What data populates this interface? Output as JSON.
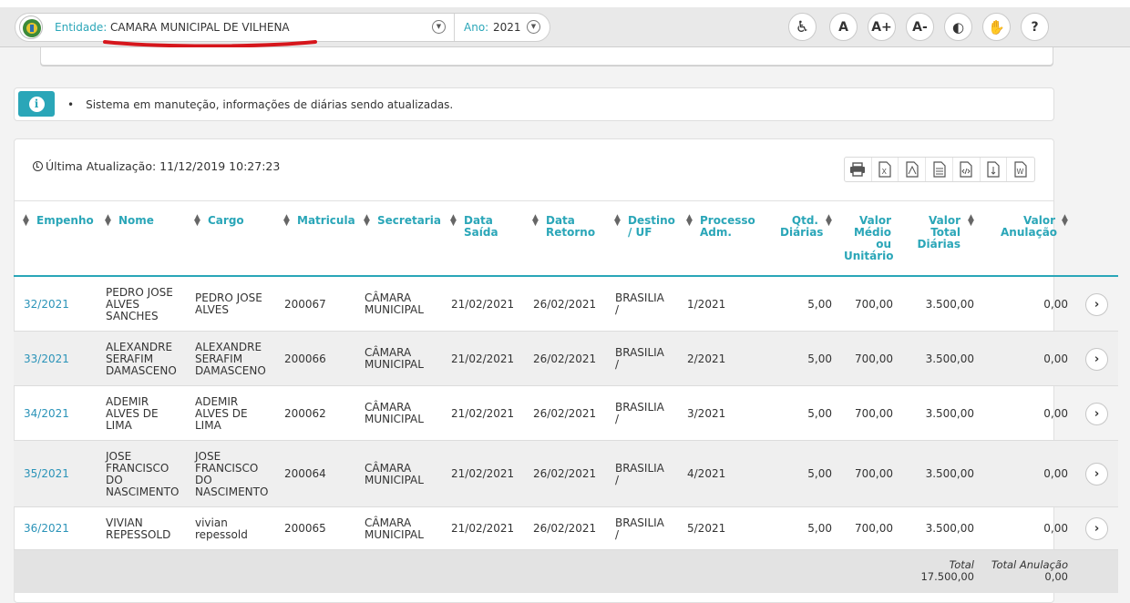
{
  "header": {
    "entity_label": "Entidade:",
    "entity_value": "CAMARA MUNICIPAL DE VILHENA",
    "year_label": "Ano:",
    "year_value": "2021",
    "accessibility": [
      {
        "name": "accessibility-icon",
        "label": "♿"
      },
      {
        "name": "font-default-button",
        "label": "A"
      },
      {
        "name": "font-increase-button",
        "label": "A+"
      },
      {
        "name": "font-decrease-button",
        "label": "A-"
      },
      {
        "name": "contrast-icon",
        "label": "◐"
      },
      {
        "name": "sign-language-icon",
        "label": "✋"
      },
      {
        "name": "help-icon",
        "label": "?"
      }
    ]
  },
  "notice": {
    "text": "Sistema em manuteção, informações de diárias sendo atualizadas."
  },
  "panel": {
    "last_update": "Última Atualização: 11/12/2019 10:27:23",
    "export_icons": [
      "print-icon",
      "excel-icon",
      "pdf-icon",
      "text-icon",
      "html-icon",
      "csv-icon",
      "word-icon"
    ]
  },
  "table": {
    "headers": {
      "empenho": "Empenho",
      "nome": "Nome",
      "cargo": "Cargo",
      "matricula": "Matricula",
      "secretaria": "Secretaria",
      "data_saida_1": "Data",
      "data_saida_2": "Saída",
      "data_retorno_1": "Data",
      "data_retorno_2": "Retorno",
      "destino_1": "Destino",
      "destino_2": "/ UF",
      "processo_1": "Processo",
      "processo_2": "Adm.",
      "qtd_1": "Qtd.",
      "qtd_2": "Diárias",
      "valor_medio_1": "Valor",
      "valor_medio_2": "Médio",
      "valor_medio_3": "ou",
      "valor_medio_4": "Unitário",
      "valor_total_1": "Valor",
      "valor_total_2": "Total",
      "valor_total_3": "Diárias",
      "valor_anul_1": "Valor",
      "valor_anul_2": "Anulação"
    },
    "rows": [
      {
        "empenho": "32/2021",
        "nome": [
          "PEDRO JOSE",
          "ALVES",
          "SANCHES"
        ],
        "cargo": [
          "PEDRO JOSE",
          "ALVES"
        ],
        "matricula": "200067",
        "secretaria": [
          "CÂMARA",
          "MUNICIPAL"
        ],
        "saida": "21/02/2021",
        "retorno": "26/02/2021",
        "destino": [
          "BRASILIA",
          "/"
        ],
        "processo": "1/2021",
        "qtd": "5,00",
        "medio": "700,00",
        "total": "3.500,00",
        "anulacao": "0,00"
      },
      {
        "empenho": "33/2021",
        "nome": [
          "ALEXANDRE",
          "SERAFIM",
          "DAMASCENO"
        ],
        "cargo": [
          "ALEXANDRE",
          "SERAFIM",
          "DAMASCENO"
        ],
        "matricula": "200066",
        "secretaria": [
          "CÂMARA",
          "MUNICIPAL"
        ],
        "saida": "21/02/2021",
        "retorno": "26/02/2021",
        "destino": [
          "BRASILIA",
          "/"
        ],
        "processo": "2/2021",
        "qtd": "5,00",
        "medio": "700,00",
        "total": "3.500,00",
        "anulacao": "0,00"
      },
      {
        "empenho": "34/2021",
        "nome": [
          "ADEMIR",
          "ALVES DE",
          "LIMA"
        ],
        "cargo": [
          "ADEMIR",
          "ALVES DE",
          "LIMA"
        ],
        "matricula": "200062",
        "secretaria": [
          "CÂMARA",
          "MUNICIPAL"
        ],
        "saida": "21/02/2021",
        "retorno": "26/02/2021",
        "destino": [
          "BRASILIA",
          "/"
        ],
        "processo": "3/2021",
        "qtd": "5,00",
        "medio": "700,00",
        "total": "3.500,00",
        "anulacao": "0,00"
      },
      {
        "empenho": "35/2021",
        "nome": [
          "JOSE",
          "FRANCISCO",
          "DO",
          "NASCIMENTO"
        ],
        "cargo": [
          "JOSE",
          "FRANCISCO",
          "DO",
          "NASCIMENTO"
        ],
        "matricula": "200064",
        "secretaria": [
          "CÂMARA",
          "MUNICIPAL"
        ],
        "saida": "21/02/2021",
        "retorno": "26/02/2021",
        "destino": [
          "BRASILIA",
          "/"
        ],
        "processo": "4/2021",
        "qtd": "5,00",
        "medio": "700,00",
        "total": "3.500,00",
        "anulacao": "0,00"
      },
      {
        "empenho": "36/2021",
        "nome": [
          "VIVIAN",
          "REPESSOLD"
        ],
        "cargo": [
          "vivian",
          "repessold"
        ],
        "matricula": "200065",
        "secretaria": [
          "CÂMARA",
          "MUNICIPAL"
        ],
        "saida": "21/02/2021",
        "retorno": "26/02/2021",
        "destino": [
          "BRASILIA",
          "/"
        ],
        "processo": "5/2021",
        "qtd": "5,00",
        "medio": "700,00",
        "total": "3.500,00",
        "anulacao": "0,00"
      }
    ],
    "totals": {
      "total_label": "Total",
      "total_value": "17.500,00",
      "anulacao_label": "Total Anulação",
      "anulacao_value": "0,00"
    }
  },
  "colors": {
    "accent": "#2aa6b8",
    "link": "#2a93b8",
    "annotation": "#d6161c"
  }
}
